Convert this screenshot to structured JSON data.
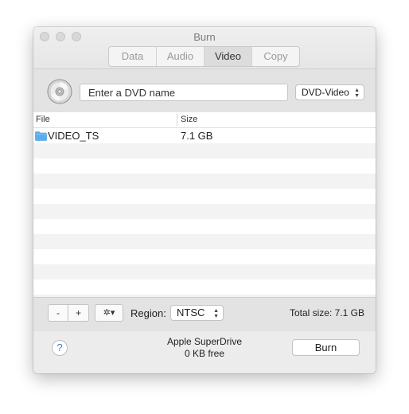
{
  "window": {
    "title": "Burn"
  },
  "tabs": [
    {
      "label": "Data",
      "active": false
    },
    {
      "label": "Audio",
      "active": false
    },
    {
      "label": "Video",
      "active": true
    },
    {
      "label": "Copy",
      "active": false
    }
  ],
  "topbar": {
    "name_placeholder": "Enter a DVD name",
    "format_selected": "DVD-Video"
  },
  "filelist": {
    "columns": [
      "File",
      "Size"
    ],
    "rows": [
      {
        "file": "VIDEO_TS",
        "size": "7.1 GB",
        "icon": "folder-icon"
      }
    ]
  },
  "bottombar": {
    "remove_label": "-",
    "add_label": "+",
    "action_icon": "gear-icon",
    "region_label": "Region:",
    "region_selected": "NTSC",
    "total_size": "Total size: 7.1 GB"
  },
  "footer": {
    "help_label": "?",
    "drive_name": "Apple SuperDrive",
    "drive_free": "0 KB free",
    "burn_label": "Burn"
  },
  "colors": {
    "folder": "#5aaef0",
    "help_accent": "#3a7bd5"
  }
}
